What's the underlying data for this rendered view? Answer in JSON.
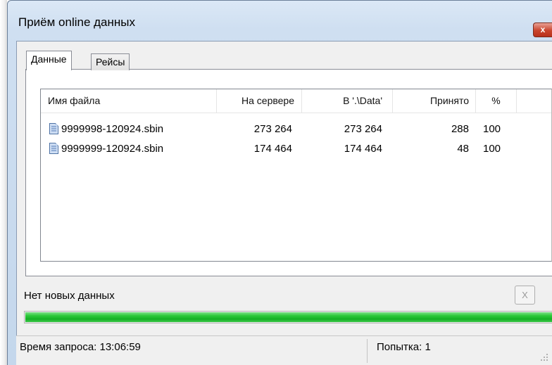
{
  "window": {
    "title": "Приём online данных",
    "close_label": "x"
  },
  "tabs": [
    {
      "label": "Данные",
      "active": true
    },
    {
      "label": "Рейсы",
      "active": false
    }
  ],
  "table": {
    "columns": [
      "Имя файла",
      "На сервере",
      "В '.\\Data'",
      "Принято",
      "%"
    ],
    "rows": [
      {
        "file": "9999998-120924.sbin",
        "server": "273 264",
        "local": "273 264",
        "received": "288",
        "percent": "100"
      },
      {
        "file": "9999999-120924.sbin",
        "server": "174 464",
        "local": "174 464",
        "received": "48",
        "percent": "100"
      }
    ]
  },
  "status": {
    "message": "Нет новых данных",
    "cancel_label": "X",
    "progress": 1.0,
    "progress_color": "#22c030"
  },
  "statusbar": {
    "left": "Время запроса: 13:06:59",
    "right": "Попытка: 1"
  }
}
